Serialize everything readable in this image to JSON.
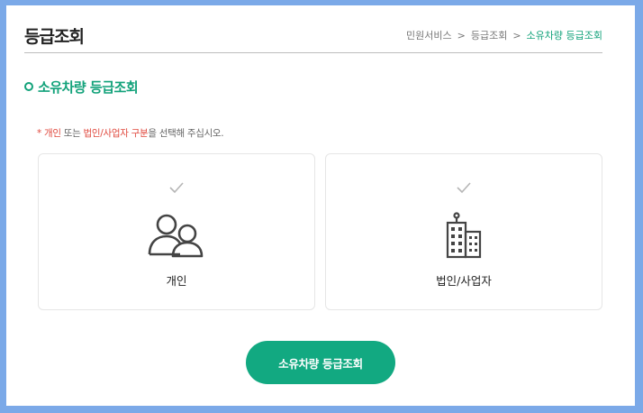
{
  "header": {
    "title": "등급조회",
    "breadcrumb": [
      "민원서비스",
      "등급조회",
      "소유차량 등급조회"
    ],
    "separator": ">"
  },
  "section": {
    "title": "소유차량 등급조회"
  },
  "notice": {
    "star": "*",
    "personal": "개인",
    "or": " 또는 ",
    "corporate": "법인/사업자 구분",
    "rest": "을 선택해 주십시오."
  },
  "options": [
    {
      "label": "개인",
      "icon": "people-icon",
      "selected": false
    },
    {
      "label": "법인/사업자",
      "icon": "building-icon",
      "selected": false
    }
  ],
  "submit_label": "소유차량 등급조회",
  "colors": {
    "accent": "#12a27a",
    "button": "#12a981",
    "notice_red": "#e04a3f",
    "frame": "#7ba9e8"
  }
}
